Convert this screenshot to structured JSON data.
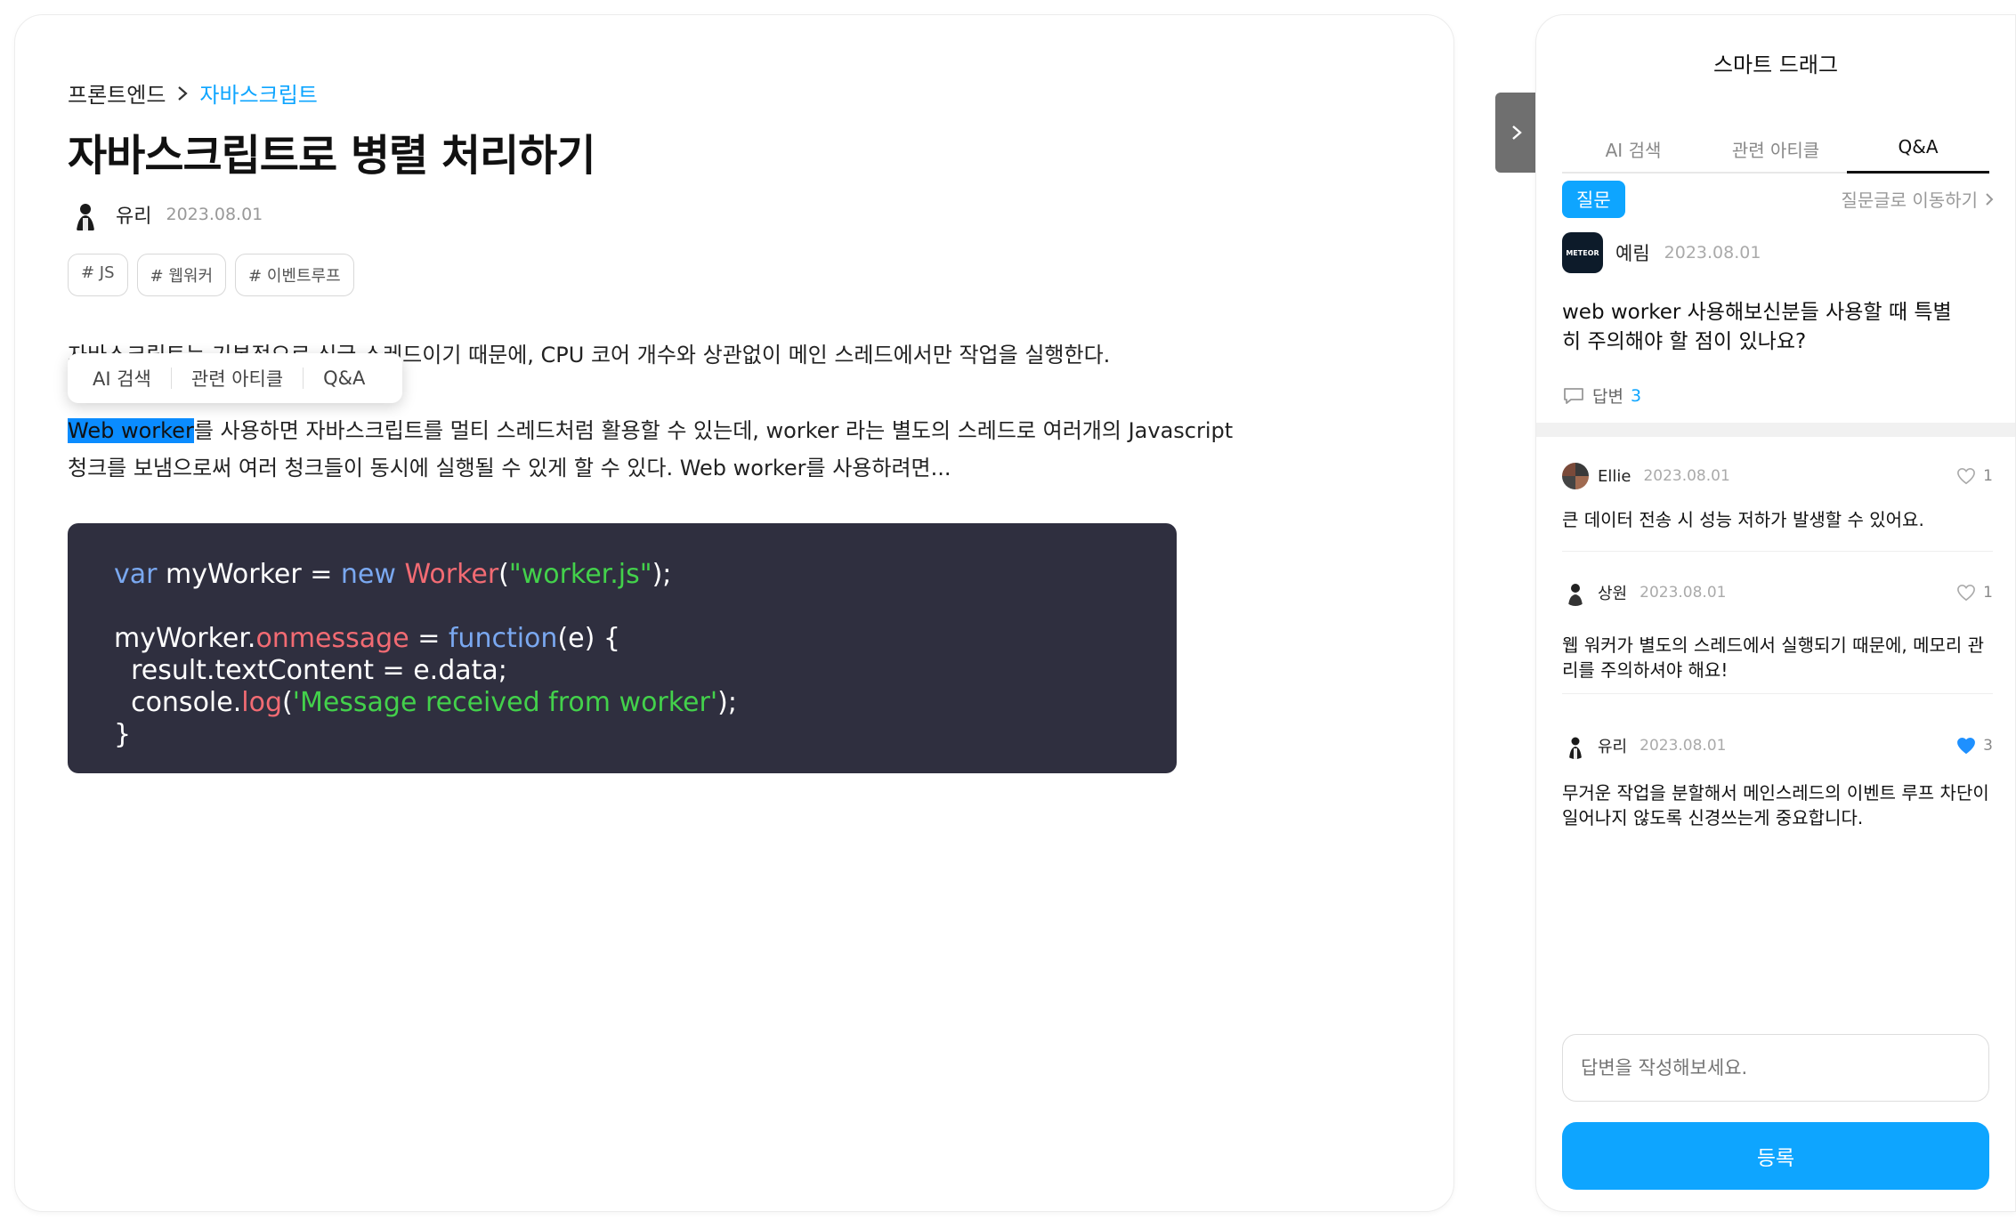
{
  "article": {
    "breadcrumb": {
      "parent": "프론트엔드",
      "current": "자바스크립트"
    },
    "title": "자바스크립트로 병렬 처리하기",
    "author": "유리",
    "date": "2023.08.01",
    "tags": [
      "# JS",
      "# 웹워커",
      "# 이벤트루프"
    ],
    "para1": "자바스크립트는 기본적으로 싱글 스레드이기 때문에, CPU 코어 개수와 상관없이 메인 스레드에서만 작업을 실행한다.",
    "para2_highlight": "Web worker",
    "para2_rest": "를 사용하면 자바스크립트를 멀티 스레드처럼 활용할 수 있는데, worker 라는 별도의 스레드로 여러개의 Javascript 청크를 보냄으로써 여러 청크들이 동시에 실행될 수 있게 할 수 있다. Web worker를 사용하려면...",
    "code": {
      "l1_kw": "var",
      "l1_a": " myWorker = ",
      "l1_new": "new",
      "l1_sp": " ",
      "l1_cls": "Worker",
      "l1_p1": "(",
      "l1_str": "\"worker.js\"",
      "l1_p2": ");",
      "l3_a": "myWorker.",
      "l3_prop": "onmessage",
      "l3_b": " = ",
      "l3_fn": "function",
      "l3_c": "(e) {",
      "l4": "  result.textContent = e.data;",
      "l5_a": "  console.",
      "l5_fn": "log",
      "l5_p1": "(",
      "l5_str": "'Message received from worker'",
      "l5_p2": ");",
      "l6": "}"
    }
  },
  "float_menu": {
    "items": [
      "AI 검색",
      "관련 아티클",
      "Q&A"
    ]
  },
  "side": {
    "title": "스마트 드래그",
    "tabs": [
      "AI 검색",
      "관련 아티클",
      "Q&A"
    ],
    "active_tab": "Q&A",
    "badge": "질문",
    "goto": "질문글로 이동하기",
    "question": {
      "logo_text": "METEOR",
      "author": "예림",
      "date": "2023.08.01",
      "text": "web worker 사용해보신분들 사용할 때 특별히 주의해야 할 점이 있나요?",
      "answer_label": "답변",
      "answer_count": "3"
    },
    "answers": [
      {
        "name": "Ellie",
        "date": "2023.08.01",
        "likes": "1",
        "liked": false,
        "text": "큰 데이터 전송 시 성능 저하가 발생할 수 있어요."
      },
      {
        "name": "상원",
        "date": "2023.08.01",
        "likes": "1",
        "liked": false,
        "text": "웹 워커가 별도의 스레드에서 실행되기 때문에, 메모리 관리를 주의하셔야 해요!"
      },
      {
        "name": "유리",
        "date": "2023.08.01",
        "likes": "3",
        "liked": true,
        "text": "무거운 작업을 분할해서 메인스레드의 이벤트 루프 차단이 일어나지 않도록 신경쓰는게 중요합니다."
      }
    ],
    "reply_placeholder": "답변을 작성해보세요.",
    "submit": "등록"
  },
  "colors": {
    "accent": "#0ea5ff",
    "highlight": "#0a8cff",
    "code_bg": "#2f2f3f",
    "like_active": "#1e90ff"
  },
  "icons": {
    "chevron_right": "chevron-right-icon",
    "comment": "comment-icon",
    "heart": "heart-icon"
  }
}
